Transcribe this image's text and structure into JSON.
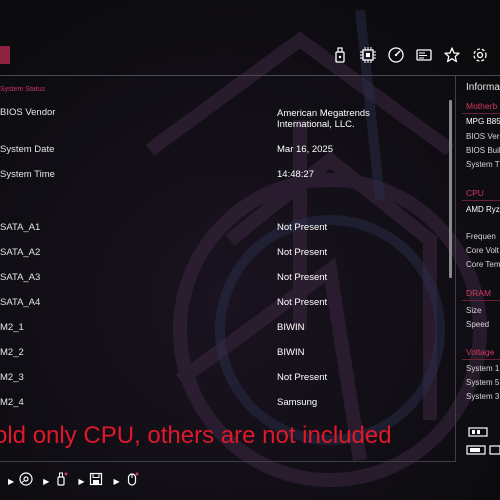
{
  "header": {
    "icons": [
      "usb-drive-icon",
      "cpu-chip-icon",
      "gauge-icon",
      "id-card-icon",
      "star-icon",
      "cog-icon"
    ]
  },
  "main": {
    "section_title": "System Status",
    "rows": [
      {
        "label": "BIOS Vendor",
        "value": "American Megatrends International, LLC."
      },
      {
        "label": "System Date",
        "value": "Mar 16, 2025"
      },
      {
        "label": "System Time",
        "value": "14:48:27"
      },
      {
        "label": "SATA_A1",
        "value": "Not Present"
      },
      {
        "label": "SATA_A2",
        "value": "Not Present"
      },
      {
        "label": "SATA_A3",
        "value": "Not Present"
      },
      {
        "label": "SATA_A4",
        "value": "Not Present"
      },
      {
        "label": "M2_1",
        "value": "BIWIN"
      },
      {
        "label": "M2_2",
        "value": "BIWIN"
      },
      {
        "label": "M2_3",
        "value": "Not Present"
      },
      {
        "label": "M2_4",
        "value": "Samsung"
      }
    ]
  },
  "info_panel": {
    "title": "Informa",
    "motherboard": {
      "heading": "Motherb",
      "model": "MPG B85",
      "lines": [
        "BIOS Vers",
        "BIOS Buil",
        "System T"
      ]
    },
    "cpu": {
      "heading": "CPU",
      "model": "AMD Ryz",
      "lines": [
        "Frequen",
        "Core Volt",
        "Core Tem"
      ]
    },
    "dram": {
      "heading": "DRAM",
      "lines": [
        "Size",
        "Speed"
      ]
    },
    "voltage": {
      "heading": "Voltage",
      "lines": [
        "System 1",
        "System 5",
        "System 3"
      ]
    }
  },
  "overlay": {
    "text": "old only CPU, others are not included",
    "color": "#e0182a"
  },
  "bottom_bar": {
    "icons": [
      "disc-icon",
      "usb-flash-icon",
      "save-icon",
      "mouse-icon"
    ]
  },
  "colors": {
    "accent": "#c8385f",
    "background": "#0b0b0e"
  }
}
